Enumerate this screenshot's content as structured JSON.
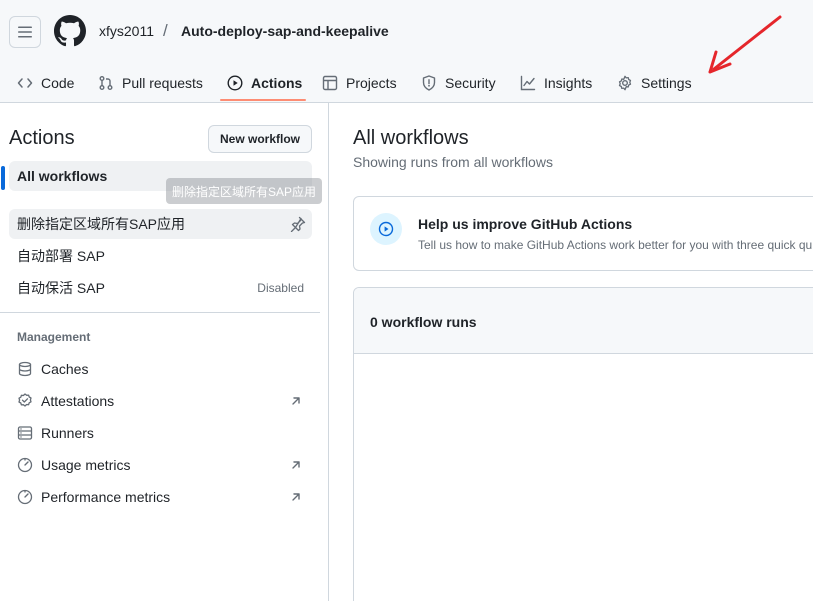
{
  "header": {
    "owner": "xfys2011",
    "separator": "/",
    "repo": "Auto-deploy-sap-and-keepalive"
  },
  "tabs": [
    {
      "label": "Code",
      "icon": "code-icon"
    },
    {
      "label": "Pull requests",
      "icon": "git-pull-request-icon"
    },
    {
      "label": "Actions",
      "icon": "play-icon",
      "active": true
    },
    {
      "label": "Projects",
      "icon": "table-icon"
    },
    {
      "label": "Security",
      "icon": "shield-icon"
    },
    {
      "label": "Insights",
      "icon": "graph-icon"
    },
    {
      "label": "Settings",
      "icon": "gear-icon"
    }
  ],
  "sidebar": {
    "title": "Actions",
    "new_workflow": "New workflow",
    "all_workflows": "All workflows",
    "tooltip": "删除指定区域所有SAP应用",
    "workflows": [
      {
        "label": "删除指定区域所有SAP应用",
        "pinned_icon": "pin-icon"
      },
      {
        "label": "自动部署 SAP"
      },
      {
        "label": "自动保活 SAP",
        "status": "Disabled"
      }
    ],
    "management_heading": "Management",
    "management": [
      {
        "label": "Caches",
        "icon": "database-icon"
      },
      {
        "label": "Attestations",
        "icon": "verified-icon",
        "external": true
      },
      {
        "label": "Runners",
        "icon": "server-icon"
      },
      {
        "label": "Usage metrics",
        "icon": "meter-icon",
        "external": true
      },
      {
        "label": "Performance metrics",
        "icon": "meter-icon",
        "external": true
      }
    ]
  },
  "main": {
    "title": "All workflows",
    "subtitle": "Showing runs from all workflows",
    "help_title": "Help us improve GitHub Actions",
    "help_desc": "Tell us how to make GitHub Actions work better for you with three quick qu",
    "runs_count": "0 workflow runs"
  },
  "colors": {
    "accent": "#0969da",
    "tab_underline": "#fd8c73",
    "annotation_arrow": "#e5262b"
  }
}
